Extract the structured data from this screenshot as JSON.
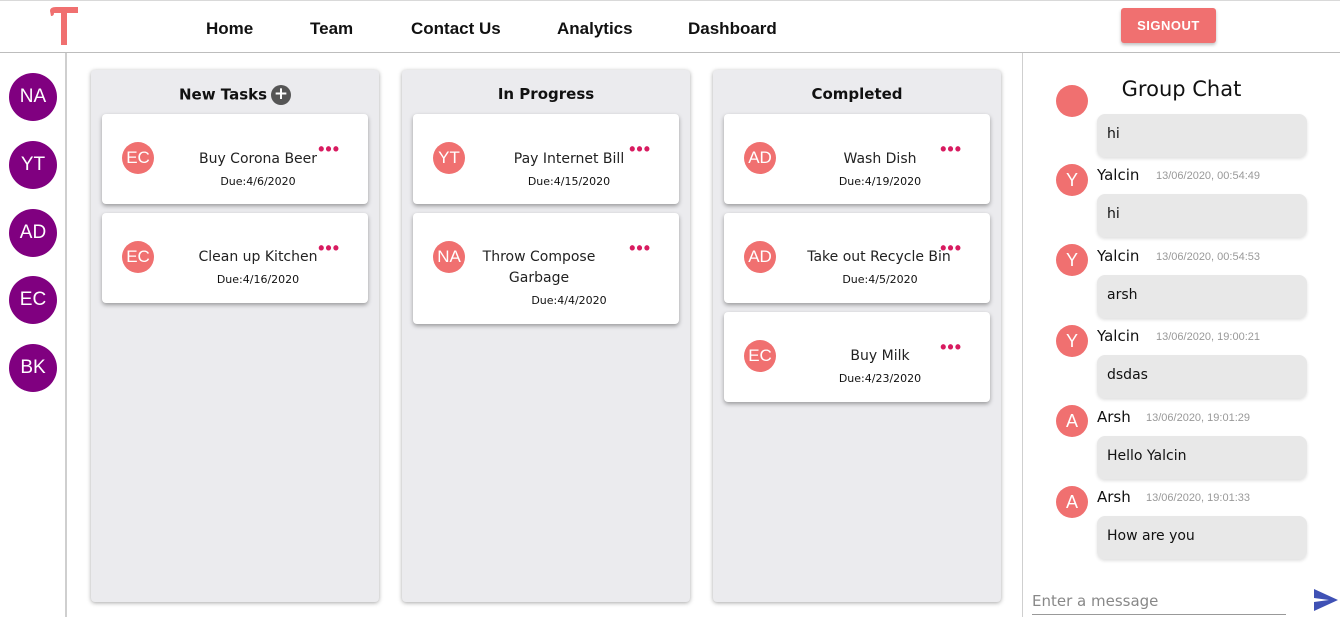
{
  "nav": {
    "items": [
      "Home",
      "Team",
      "Contact Us",
      "Analytics",
      "Dashboard"
    ],
    "signout_label": "SIGNOUT",
    "brand_color": "#f07070"
  },
  "members": [
    "NA",
    "YT",
    "AD",
    "EC",
    "BK"
  ],
  "columns": [
    {
      "title": "New Tasks",
      "cards": [
        {
          "initials": "EC",
          "title": "Buy Corona Beer",
          "due": "Due:4/6/2020"
        },
        {
          "initials": "EC",
          "title": "Clean up Kitchen",
          "due": "Due:4/16/2020"
        }
      ]
    },
    {
      "title": "In Progress",
      "cards": [
        {
          "initials": "YT",
          "title": "Pay Internet Bill",
          "due": "Due:4/15/2020"
        },
        {
          "initials": "NA",
          "title": "Throw Compose Garbage",
          "due": "Due:4/4/2020"
        }
      ]
    },
    {
      "title": "Completed",
      "cards": [
        {
          "initials": "AD",
          "title": "Wash Dish",
          "due": "Due:4/19/2020"
        },
        {
          "initials": "AD",
          "title": "Take out Recycle Bin",
          "due": "Due:4/5/2020"
        },
        {
          "initials": "EC",
          "title": "Buy Milk",
          "due": "Due:4/23/2020"
        }
      ]
    }
  ],
  "card_menu_glyph": "•••",
  "add_icon_glyph": "+",
  "chat": {
    "title": "Group Chat",
    "first_bubble": "hi",
    "messages": [
      {
        "initial": "Y",
        "name": "Yalcin",
        "time": "13/06/2020, 00:54:49",
        "text": "hi"
      },
      {
        "initial": "Y",
        "name": "Yalcin",
        "time": "13/06/2020, 00:54:53",
        "text": "arsh"
      },
      {
        "initial": "Y",
        "name": "Yalcin",
        "time": "13/06/2020, 19:00:21",
        "text": "dsdas"
      },
      {
        "initial": "A",
        "name": "Arsh",
        "time": "13/06/2020, 19:01:29",
        "text": "Hello Yalcin"
      },
      {
        "initial": "A",
        "name": "Arsh",
        "time": "13/06/2020, 19:01:33",
        "text": "How are you"
      }
    ],
    "input_placeholder": "Enter a message"
  },
  "colors": {
    "member_avatar": "#800080",
    "task_avatar": "#f07070",
    "menu_dots": "#d81b60",
    "send_icon": "#3f51b5"
  }
}
